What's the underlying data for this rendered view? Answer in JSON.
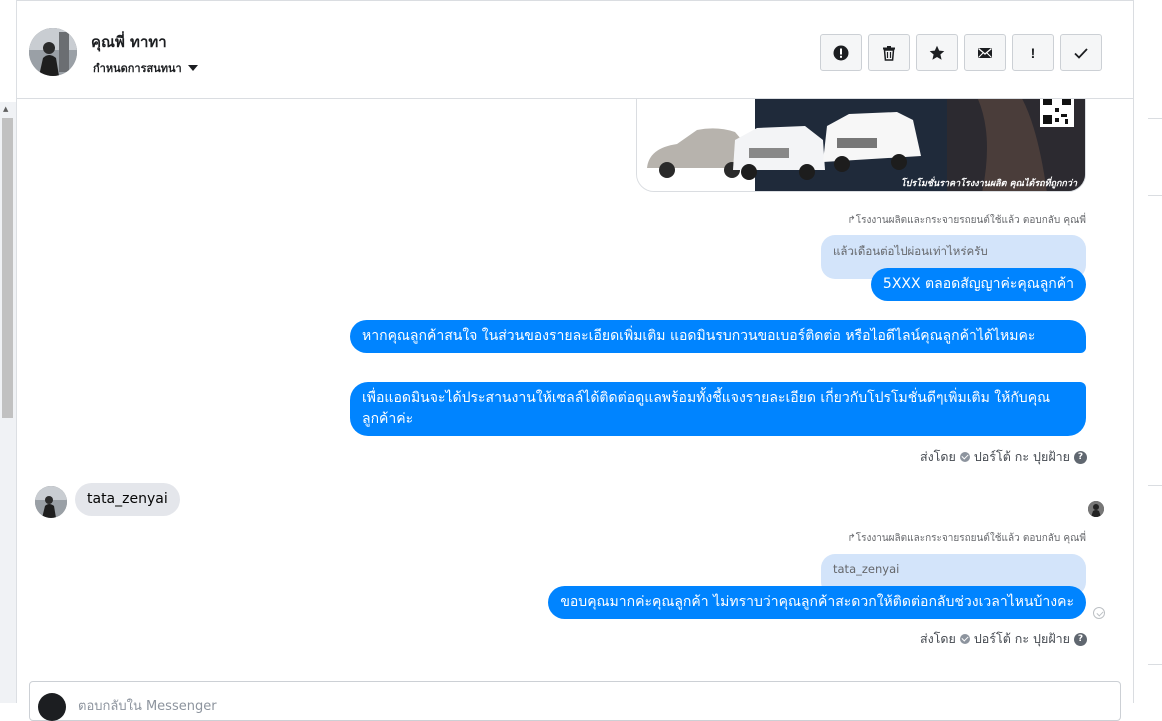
{
  "header": {
    "contact_name": "คุณพี่ ทาทา",
    "conversation_settings": "กำหนดการสนทนา",
    "toolbar": [
      {
        "name": "report-spam-button",
        "icon": "exclamation-circle-icon"
      },
      {
        "name": "delete-button",
        "icon": "trash-icon"
      },
      {
        "name": "star-button",
        "icon": "star-icon"
      },
      {
        "name": "mark-unread-button",
        "icon": "envelope-icon"
      },
      {
        "name": "flag-important-button",
        "icon": "exclamation-icon",
        "label": "!"
      },
      {
        "name": "mark-done-button",
        "icon": "checkmark-icon"
      }
    ]
  },
  "chat": {
    "promo_image_caption": "โปรโมชั่นราคาโรงงานผลิต คุณได้รถที่ถูกกว่า",
    "reply_note_1": "โรงงานผลิตและกระจายรถยนต์ใช้แล้ว ตอบกลับ คุณพี่",
    "quoted_1": "แล้วเดือนต่อไปผ่อนเท่าไหร่ครับ",
    "msg_1": "5XXX ตลอดสัญญาค่ะคุณลูกค้า",
    "msg_2": "หากคุณลูกค้าสนใจ ในส่วนของรายละเอียดเพิ่มเติม แอดมินรบกวนขอเบอร์ติดต่อ หรือไอดีไลน์คุณลูกค้าได้ไหมคะ",
    "msg_3": "เพื่อแอดมินจะได้ประสานงานให้เซลล์ได้ติดต่อดูแลพร้อมทั้งชี้แจงรายละเอียด เกี่ยวกับโปรโมชั่นดีๆเพิ่มเติม ให้กับคุณลูกค้าค่ะ",
    "sent_by_label": "ส่งโดย",
    "sent_by_name": "ปอร์โต้ กะ ปุยฝ้าย",
    "help_glyph": "?",
    "incoming_msg": "tata_zenyai",
    "reply_note_2": "โรงงานผลิตและกระจายรถยนต์ใช้แล้ว ตอบกลับ คุณพี่",
    "quoted_2": "tata_zenyai",
    "msg_4": "ขอบคุณมากค่ะคุณลูกค้า ไม่ทราบว่าคุณลูกค้าสะดวกให้ติดต่อกลับช่วงเวลาไหนบ้างคะ",
    "sent_by_label_2": "ส่งโดย",
    "sent_by_name_2": "ปอร์โต้ กะ ปุยฝ้าย"
  },
  "composer": {
    "placeholder": "ตอบกลับใน Messenger"
  },
  "colors": {
    "outgoing_bubble": "#0084ff",
    "incoming_bubble": "#e4e6eb",
    "quoted_bubble": "#d3e4fa"
  }
}
